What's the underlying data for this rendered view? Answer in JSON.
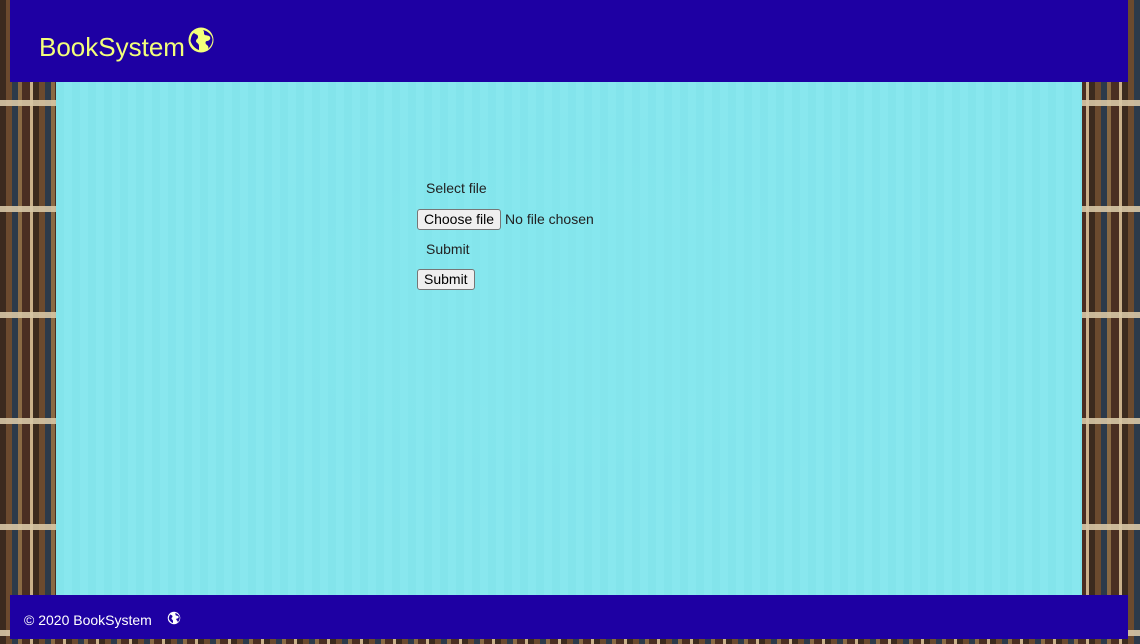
{
  "header": {
    "brand": "BookSystem",
    "brand_icon": "globe-icon",
    "background_color": "#1e00a3",
    "brand_color": "#f3ff7a"
  },
  "form": {
    "file_label": "Select file",
    "choose_file_button": "Choose file",
    "file_status": "No file chosen",
    "submit_label": "Submit",
    "submit_button": "Submit"
  },
  "footer": {
    "text": "© 2020 BookSystem",
    "icon": "globe-icon",
    "background_color": "#1e00a3"
  },
  "main": {
    "overlay_color": "#88e8ee"
  }
}
